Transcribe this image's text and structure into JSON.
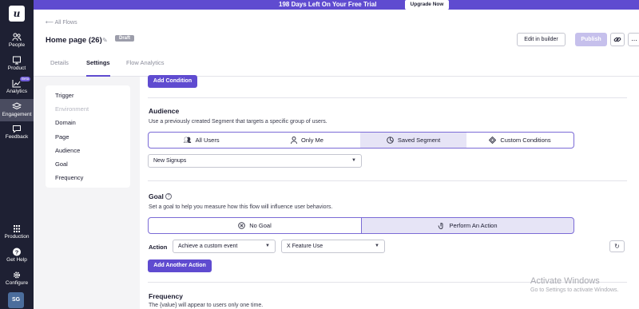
{
  "banner": {
    "text": "198 Days Left On Your Free Trial",
    "upgrade_label": "Upgrade Now"
  },
  "rail": {
    "logo": "u",
    "items": [
      {
        "label": "People",
        "icon": "people-icon"
      },
      {
        "label": "Product",
        "icon": "product-icon"
      },
      {
        "label": "Analytics",
        "icon": "analytics-icon",
        "badge": "Beta"
      },
      {
        "label": "Engagement",
        "icon": "engagement-icon",
        "active": true
      },
      {
        "label": "Feedback",
        "icon": "feedback-icon"
      },
      {
        "label": "Production",
        "icon": "apps-grid-icon"
      },
      {
        "label": "Get Help",
        "icon": "help-icon"
      },
      {
        "label": "Configure",
        "icon": "gear-icon"
      }
    ],
    "avatar": "SG"
  },
  "header": {
    "back_label": "All Flows",
    "title": "Home page (26)",
    "status_badge": "Draft",
    "edit_label": "Edit in builder",
    "publish_label": "Publish",
    "more_label": "..."
  },
  "tabs": [
    {
      "label": "Details",
      "active": false
    },
    {
      "label": "Settings",
      "active": true
    },
    {
      "label": "Flow Analytics",
      "active": false
    }
  ],
  "settings_nav": [
    {
      "label": "Trigger",
      "disabled": false
    },
    {
      "label": "Environment",
      "disabled": true
    },
    {
      "label": "Domain",
      "disabled": false
    },
    {
      "label": "Page",
      "disabled": false
    },
    {
      "label": "Audience",
      "disabled": false
    },
    {
      "label": "Goal",
      "disabled": false
    },
    {
      "label": "Frequency",
      "disabled": false
    }
  ],
  "trigger": {
    "add_condition_label": "Add Condition"
  },
  "audience": {
    "title": "Audience",
    "description": "Use a previously created Segment that targets a specific group of users.",
    "options": [
      {
        "label": "All Users",
        "icon": "users-icon"
      },
      {
        "label": "Only Me",
        "icon": "user-icon"
      },
      {
        "label": "Saved Segment",
        "icon": "pie-chart-icon",
        "selected": true
      },
      {
        "label": "Custom Conditions",
        "icon": "diamond-icon"
      }
    ],
    "segment_value": "New Signups"
  },
  "goal": {
    "title": "Goal",
    "description": "Set a goal to help you measure how this flow will influence user behaviors.",
    "options": [
      {
        "label": "No Goal",
        "icon": "x-circle-icon"
      },
      {
        "label": "Perform An Action",
        "icon": "action-icon",
        "selected": true
      }
    ],
    "action_label": "Action",
    "action_type_value": "Achieve a custom event",
    "event_value": "X Feature Use",
    "add_another_label": "Add Another Action"
  },
  "frequency": {
    "title": "Frequency",
    "description": "The {value} will appear to users only one time."
  },
  "watermark": {
    "title": "Activate Windows",
    "subtitle": "Go to Settings to activate Windows."
  }
}
